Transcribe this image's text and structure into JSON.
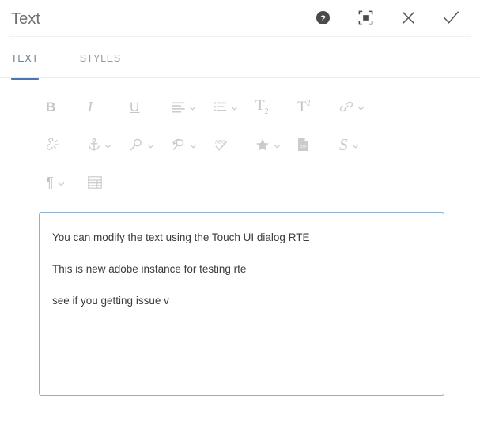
{
  "header": {
    "title": "Text",
    "actions": [
      {
        "name": "help-icon",
        "label": "Help"
      },
      {
        "name": "fullscreen-icon",
        "label": "Fullscreen"
      },
      {
        "name": "close-icon",
        "label": "Close"
      },
      {
        "name": "confirm-check-icon",
        "label": "Done"
      }
    ]
  },
  "tabs": [
    {
      "label": "TEXT",
      "active": true
    },
    {
      "label": "STYLES",
      "active": false
    }
  ],
  "toolbar": {
    "rows": [
      [
        {
          "name": "bold-button",
          "glyph": "B",
          "type": "text-bold",
          "caret": false
        },
        {
          "name": "italic-button",
          "glyph": "I",
          "type": "text-italic",
          "caret": false
        },
        {
          "name": "underline-button",
          "glyph": "U",
          "type": "text-underline",
          "caret": false
        },
        {
          "name": "align-justify-icon",
          "glyph": "align",
          "type": "icon",
          "caret": true
        },
        {
          "name": "bullet-list-icon",
          "glyph": "list",
          "type": "icon",
          "caret": true
        },
        {
          "name": "subscript-button",
          "glyph": "T2",
          "type": "subscript",
          "caret": false
        },
        {
          "name": "superscript-button",
          "glyph": "T2",
          "type": "superscript",
          "caret": false
        },
        {
          "name": "link-icon",
          "glyph": "link",
          "type": "icon",
          "caret": true
        }
      ],
      [
        {
          "name": "unlink-icon",
          "glyph": "unlink",
          "type": "icon",
          "caret": false
        },
        {
          "name": "anchor-icon",
          "glyph": "anchor",
          "type": "icon",
          "caret": true
        },
        {
          "name": "find-icon",
          "glyph": "find",
          "type": "icon",
          "caret": true
        },
        {
          "name": "find-replace-icon",
          "glyph": "replace",
          "type": "icon",
          "caret": true
        },
        {
          "name": "spellcheck-icon",
          "glyph": "spellcheck",
          "type": "icon",
          "caret": false
        },
        {
          "name": "special-char-star-icon",
          "glyph": "star",
          "type": "icon",
          "caret": true
        },
        {
          "name": "source-edit-icon",
          "glyph": "source",
          "type": "icon",
          "caret": false
        },
        {
          "name": "styles-button",
          "glyph": "S",
          "type": "text-serif",
          "caret": true
        }
      ],
      [
        {
          "name": "paragraph-format-icon",
          "glyph": "pilcrow",
          "type": "text-pilcrow",
          "caret": true
        },
        {
          "name": "table-icon",
          "glyph": "table",
          "type": "icon",
          "caret": false
        }
      ]
    ]
  },
  "editor": {
    "paragraphs": [
      "You can modify the text using the Touch UI dialog RTE",
      "This is new adobe instance for testing rte",
      "see if you getting issue v"
    ]
  },
  "colors": {
    "accent_blue": "#4a75b2",
    "editor_border": "#8fb0cc",
    "icon_gray": "#c9cbcd",
    "title_gray": "#707070",
    "body_text": "#3b3b3b"
  }
}
